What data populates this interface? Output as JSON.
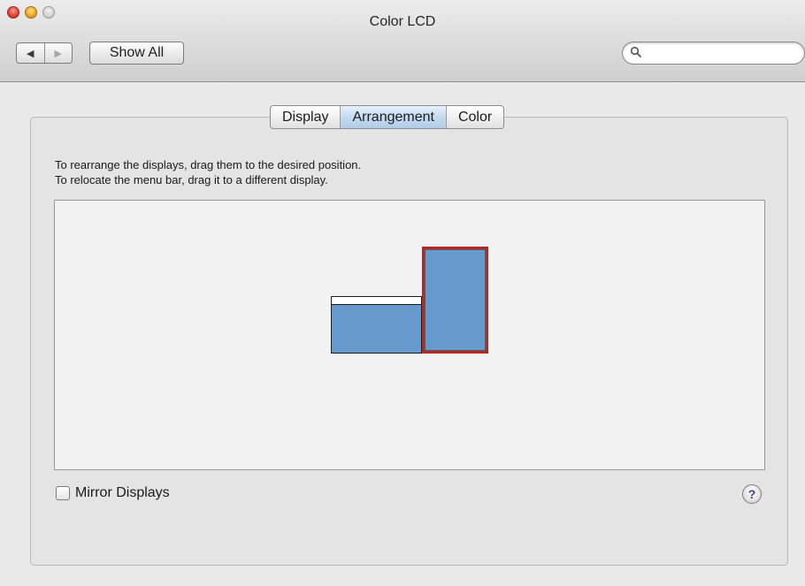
{
  "window": {
    "title": "Color LCD"
  },
  "toolbar": {
    "back_glyph": "◀",
    "forward_glyph": "▶",
    "show_all_label": "Show All",
    "search": {
      "value": "",
      "placeholder": ""
    }
  },
  "tabs": [
    {
      "label": "Display",
      "active": false
    },
    {
      "label": "Arrangement",
      "active": true
    },
    {
      "label": "Color",
      "active": false
    }
  ],
  "instructions": {
    "line1": "To rearrange the displays, drag them to the desired position.",
    "line2": "To relocate the menu bar, drag it to a different display."
  },
  "arrangement": {
    "displays": [
      {
        "name": "primary",
        "has_menu_bar": true,
        "selected": false
      },
      {
        "name": "secondary",
        "has_menu_bar": false,
        "selected": true
      }
    ]
  },
  "mirror": {
    "label": "Mirror Displays",
    "checked": false
  },
  "help": {
    "glyph": "?"
  },
  "colors": {
    "display_fill": "#6699cc",
    "selection_border": "#b22a22",
    "active_tab": "#c4daef",
    "help_glyph": "#5b2f91"
  }
}
